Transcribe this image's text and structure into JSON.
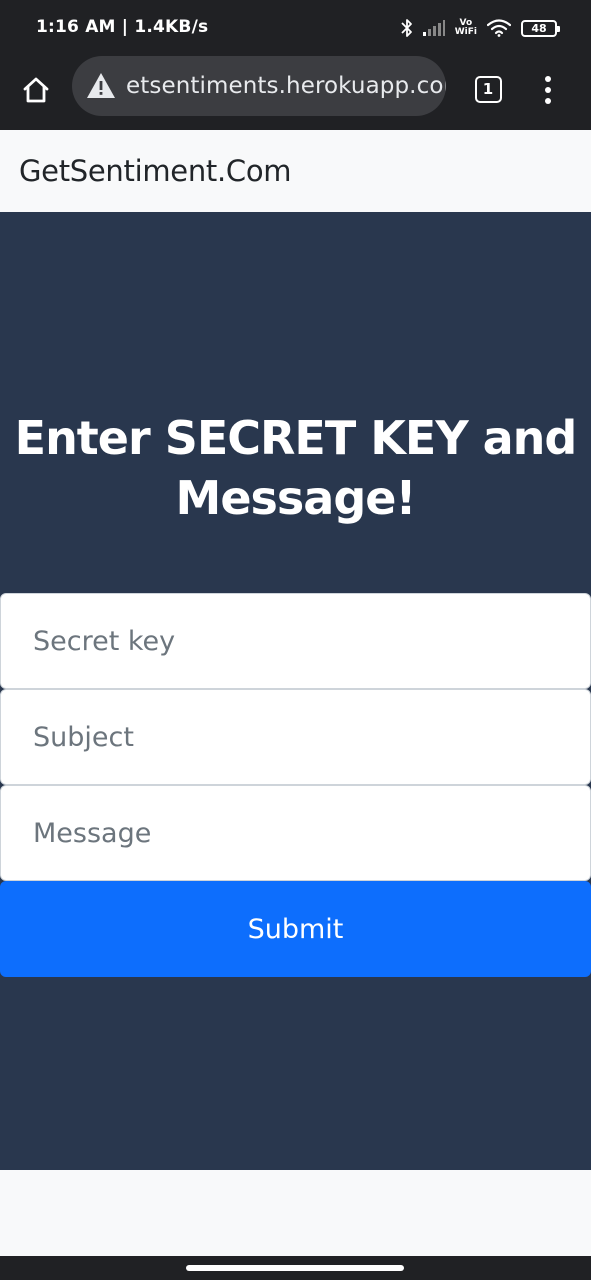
{
  "status_bar": {
    "time": "1:16 AM | 1.4KB/s",
    "vowifi_top": "Vo",
    "vowifi_bottom": "WiFi",
    "battery": "48",
    "icons": [
      "bluetooth-icon",
      "signal-icon",
      "vowifi-icon",
      "wifi-icon",
      "battery-icon"
    ]
  },
  "browser": {
    "url": "getsentiments.herokuapp.com",
    "url_visible": "etsentiments.herokuapp.com",
    "tab_count": "1",
    "icons": [
      "home-icon",
      "warning-icon",
      "tabs-icon",
      "more-vert-icon"
    ]
  },
  "navbar": {
    "brand": "GetSentiment.Com"
  },
  "hero": {
    "title_line1": "Enter SECRET KEY and",
    "title_line2": "Message!"
  },
  "form": {
    "secret_key_placeholder": "Secret key",
    "subject_placeholder": "Subject",
    "message_placeholder": "Message",
    "submit_label": "Submit"
  },
  "colors": {
    "hero_bg": "#29374e",
    "button_blue": "#0d6efd",
    "navbar_bg": "#f8f9fa",
    "chrome_bg": "#202124"
  }
}
